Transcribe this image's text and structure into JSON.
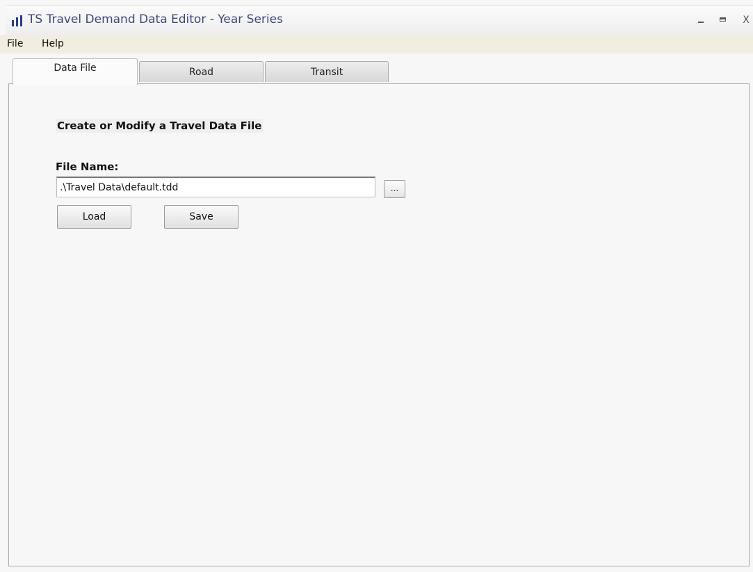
{
  "window": {
    "title": "TS Travel Demand Data Editor - Year Series",
    "icon": "bar-chart-icon",
    "controls": {
      "minimize": "–",
      "maximize": "□",
      "close": "X"
    }
  },
  "menu": {
    "items": [
      {
        "label": "File"
      },
      {
        "label": "Help"
      }
    ]
  },
  "tabs": [
    {
      "label": "Data File",
      "active": true
    },
    {
      "label": "Road",
      "active": false
    },
    {
      "label": "Transit",
      "active": false
    }
  ],
  "data_file": {
    "heading": "Create or Modify a Travel Data File",
    "file_name_label": "File Name:",
    "file_name_value": ".\\Travel Data\\default.tdd",
    "browse_label": "...",
    "load_label": "Load",
    "save_label": "Save"
  },
  "colors": {
    "title_text": "#3c4a7a",
    "menubar_bg": "#f1ede0",
    "panel_bg": "#f6f7f6"
  }
}
